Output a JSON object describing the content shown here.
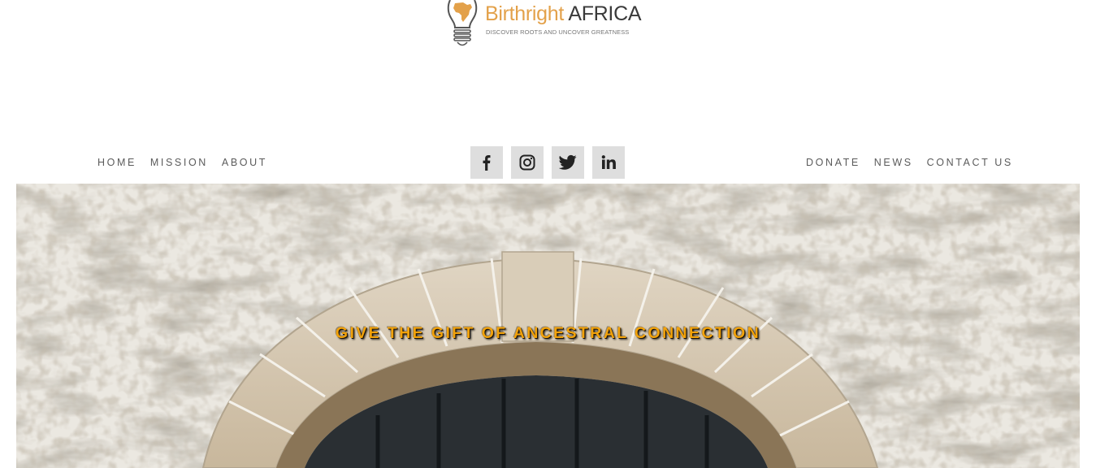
{
  "brand": {
    "name_part1": "Birthright",
    "name_part2": "AFRICA",
    "tagline": "DISCOVER ROOTS AND UNCOVER GREATNESS",
    "logo_icon": "lightbulb-africa-icon",
    "colors": {
      "accent": "#e3a14a",
      "dark": "#3a3a3a"
    }
  },
  "nav": {
    "left": [
      {
        "label": "HOME"
      },
      {
        "label": "MISSION"
      },
      {
        "label": "ABOUT"
      }
    ],
    "right": [
      {
        "label": "DONATE"
      },
      {
        "label": "NEWS"
      },
      {
        "label": "CONTACT US"
      }
    ]
  },
  "social": [
    {
      "icon": "facebook-icon"
    },
    {
      "icon": "instagram-icon"
    },
    {
      "icon": "twitter-icon"
    },
    {
      "icon": "linkedin-icon"
    }
  ],
  "hero": {
    "heading": "GIVE THE GIFT OF ANCESTRAL CONNECTION",
    "heading_color": "#f2a20a",
    "image": "stone-arch-doorway"
  }
}
